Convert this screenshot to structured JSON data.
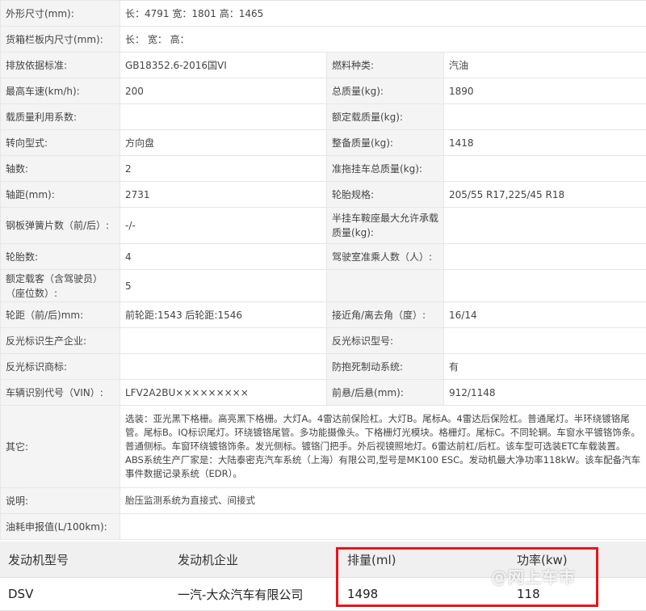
{
  "spec_rows": [
    {
      "cells": [
        "外形尺寸(mm):",
        "长：4791 宽：1801 高：1465"
      ]
    },
    {
      "cells": [
        "货箱栏板内尺寸(mm):",
        "长：  宽：  高："
      ]
    },
    {
      "cells": [
        "排放依据标准:",
        "GB18352.6-2016国VI",
        "燃料种类:",
        "汽油"
      ]
    },
    {
      "cells": [
        "最高车速(km/h):",
        "200",
        "总质量(kg):",
        "1890"
      ]
    },
    {
      "cells": [
        "载质量利用系数:",
        "",
        "额定载质量(kg):",
        ""
      ]
    },
    {
      "cells": [
        "转向型式:",
        "方向盘",
        "整备质量(kg):",
        "1418"
      ]
    },
    {
      "cells": [
        "轴数:",
        "2",
        "准拖挂车总质量(kg):",
        ""
      ]
    },
    {
      "cells": [
        "轴距(mm):",
        "2731",
        "轮胎规格:",
        "205/55 R17,225/45 R18"
      ]
    },
    {
      "cells": [
        "钢板弹簧片数（前/后）:",
        "-/-",
        "半挂车鞍座最大允许承载质量(kg):",
        ""
      ]
    },
    {
      "cells": [
        "轮胎数:",
        "4",
        "驾驶室准乘人数（人）:",
        ""
      ]
    },
    {
      "cells": [
        "额定载客（含驾驶员）（座位数）:",
        "5",
        "",
        ""
      ]
    },
    {
      "cells": [
        "轮距（前/后)mm:",
        "前轮距:1543 后轮距:1546",
        "接近角/离去角（度）:",
        "16/14"
      ]
    },
    {
      "cells": [
        "反光标识生产企业:",
        "",
        "反光标识型号:",
        ""
      ]
    },
    {
      "cells": [
        "反光标识商标:",
        "",
        "防抱死制动系统:",
        "有"
      ]
    },
    {
      "cells": [
        "车辆识别代号（VIN）:",
        "LFV2A2BU×××××××××",
        "前悬/后悬(mm):",
        "912/1148"
      ]
    }
  ],
  "other": {
    "label": "其它:",
    "text": "选装：亚光黑下格栅。高亮黑下格栅。大灯A。4雷达前保险杠。大灯B。尾标A。4雷达后保险杠。普通尾灯。半环绕镀铬尾管。尾标B。IQ标识尾灯。环绕镀铬尾管。多功能摄像头。下格栅灯光模块。格栅灯。尾标C。不同轮辋。车窗水平镀铬饰条。普通侧标。车窗环绕镀铬饰条。发光侧标。镀铬门把手。外后视镜照地灯。6雷达前杠/后杠。该车型可选装ETC车载装置。ABS系统生产厂家是：大陆泰密克汽车系统（上海）有限公司,型号是MK100 ESC。发动机最大净功率118kW。该车配备汽车事件数据记录系统（EDR）。"
  },
  "notes": {
    "label": "说明:",
    "text": "胎压监测系统为直接式、间接式"
  },
  "fuel": {
    "label": "油耗申报值(L/100km):",
    "text": ""
  },
  "engine": {
    "headers": [
      "发动机型号",
      "发动机企业",
      "排量(ml)",
      "功率(kw)"
    ],
    "row": [
      "DSV",
      "一汽-大众汽车有限公司",
      "1498",
      "118"
    ]
  },
  "watermark": "@网上车市",
  "chart_data": {
    "type": "table",
    "columns": [
      "发动机型号",
      "发动机企业",
      "排量(ml)",
      "功率(kw)"
    ],
    "rows": [
      [
        "DSV",
        "一汽-大众汽车有限公司",
        "1498",
        "118"
      ]
    ]
  },
  "colors": {
    "highlight": "#e8141c",
    "label_bg": "#f4f4f4",
    "engine_header_bg": "#f0f0f0"
  }
}
